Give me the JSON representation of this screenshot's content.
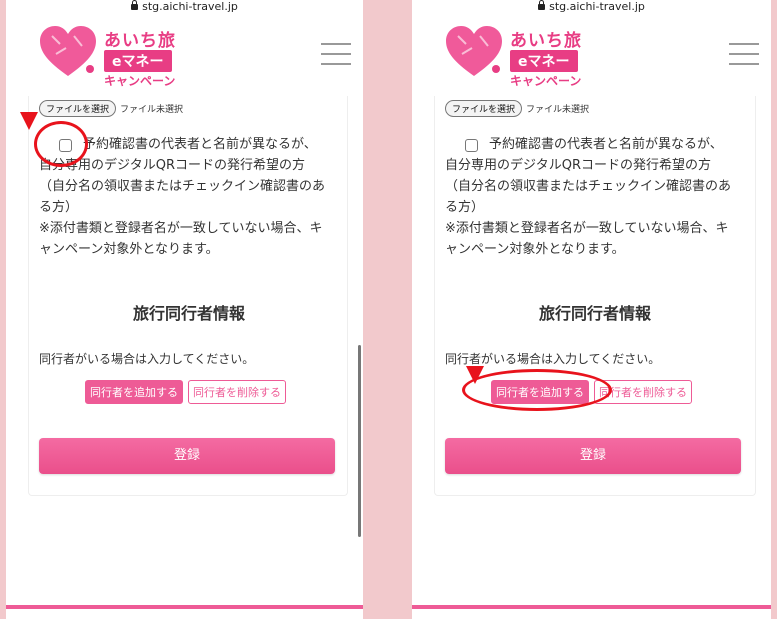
{
  "url": "stg.aichi-travel.jp",
  "logo": {
    "line1": "あいち旅",
    "line2": "eマネー",
    "line3": "キャンペーン"
  },
  "file_input": {
    "button": "ファイルを選択",
    "status": "ファイル未選択"
  },
  "notice": {
    "checkbox_text": "予約確認書の代表者と名前が異なるが、自分専用のデジタルQRコードの発行希望の方",
    "sub_text": "（自分名の領収書またはチェックイン確認書のある方）",
    "warning": "※添付書類と登録者名が一致していない場合、キャンペーン対象外となります。"
  },
  "companion": {
    "title": "旅行同行者情報",
    "info": "同行者がいる場合は入力してください。",
    "add_button": "同行者を追加する",
    "delete_button": "同行者を削除する"
  },
  "submit_label": "登録",
  "colors": {
    "brand_pink": "#ee5b96",
    "annotation_red": "#e8131c"
  }
}
